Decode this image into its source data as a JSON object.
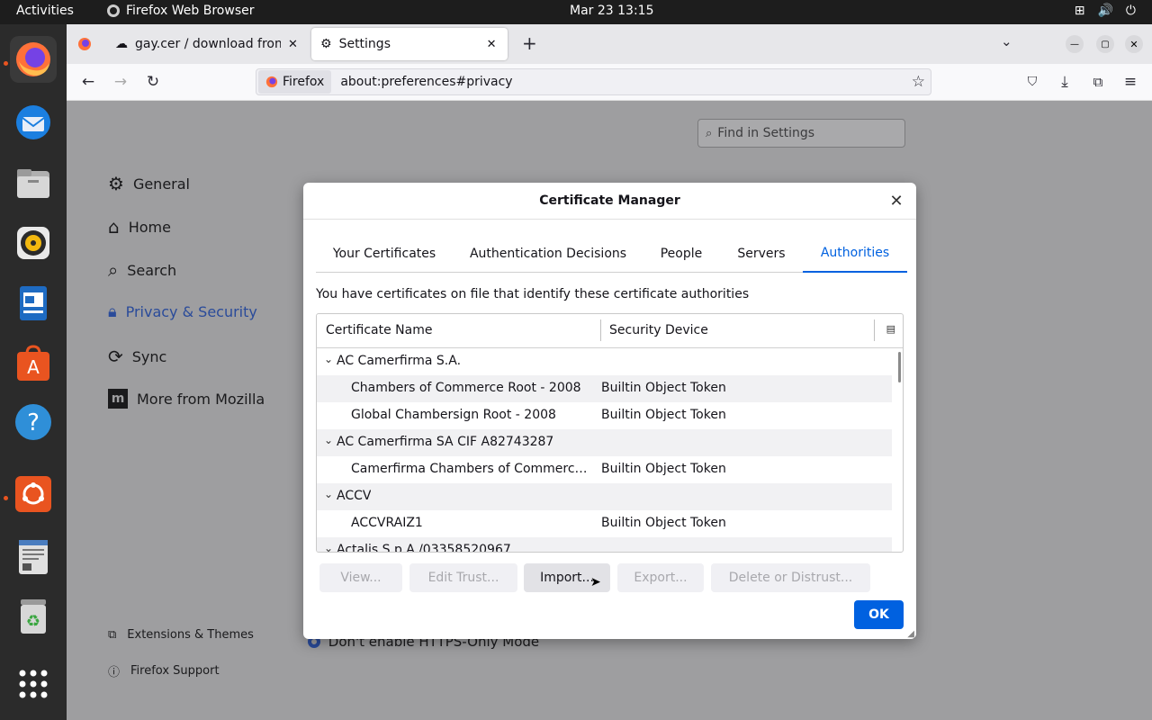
{
  "topbar": {
    "activities": "Activities",
    "app_name": "Firefox Web Browser",
    "clock": "Mar 23  13:15"
  },
  "dock": {
    "apps": [
      "firefox-icon",
      "thunderbird-icon",
      "files-icon",
      "rhythmbox-icon",
      "writer-icon",
      "app-center-icon",
      "help-icon",
      "ubuntu-icon",
      "text-editor-icon",
      "trash-icon",
      "app-grid-icon"
    ]
  },
  "tabs": [
    {
      "label": "gay.cer / download from"
    },
    {
      "label": "Settings"
    }
  ],
  "urlbar": {
    "identity": "Firefox",
    "url": "about:preferences#privacy"
  },
  "settings": {
    "search_placeholder": "Find in Settings",
    "nav": [
      {
        "label": "General"
      },
      {
        "label": "Home"
      },
      {
        "label": "Search"
      },
      {
        "label": "Privacy & Security"
      },
      {
        "label": "Sync"
      },
      {
        "label": "More from Mozilla"
      }
    ],
    "footer": [
      {
        "label": "Extensions & Themes"
      },
      {
        "label": "Firefox Support"
      }
    ],
    "bg_option": "Don't enable HTTPS-Only Mode"
  },
  "dialog": {
    "title": "Certificate Manager",
    "tabs": [
      "Your Certificates",
      "Authentication Decisions",
      "People",
      "Servers",
      "Authorities"
    ],
    "description": "You have certificates on file that identify these certificate authorities",
    "columns": [
      "Certificate Name",
      "Security Device"
    ],
    "rows": [
      {
        "name": "AC Camerfirma S.A.",
        "device": "",
        "group": true
      },
      {
        "name": "Chambers of Commerce Root - 2008",
        "device": "Builtin Object Token",
        "group": false
      },
      {
        "name": "Global Chambersign Root - 2008",
        "device": "Builtin Object Token",
        "group": false
      },
      {
        "name": "AC Camerfirma SA CIF A82743287",
        "device": "",
        "group": true
      },
      {
        "name": "Camerfirma Chambers of Commerce ...",
        "device": "Builtin Object Token",
        "group": false
      },
      {
        "name": "ACCV",
        "device": "",
        "group": true
      },
      {
        "name": "ACCVRAIZ1",
        "device": "Builtin Object Token",
        "group": false
      },
      {
        "name": "Actalis S.p.A./03358520967",
        "device": "",
        "group": true
      }
    ],
    "buttons": {
      "view": "View...",
      "edit_trust": "Edit Trust...",
      "import": "Import...",
      "export": "Export...",
      "delete": "Delete or Distrust...",
      "ok": "OK"
    }
  }
}
